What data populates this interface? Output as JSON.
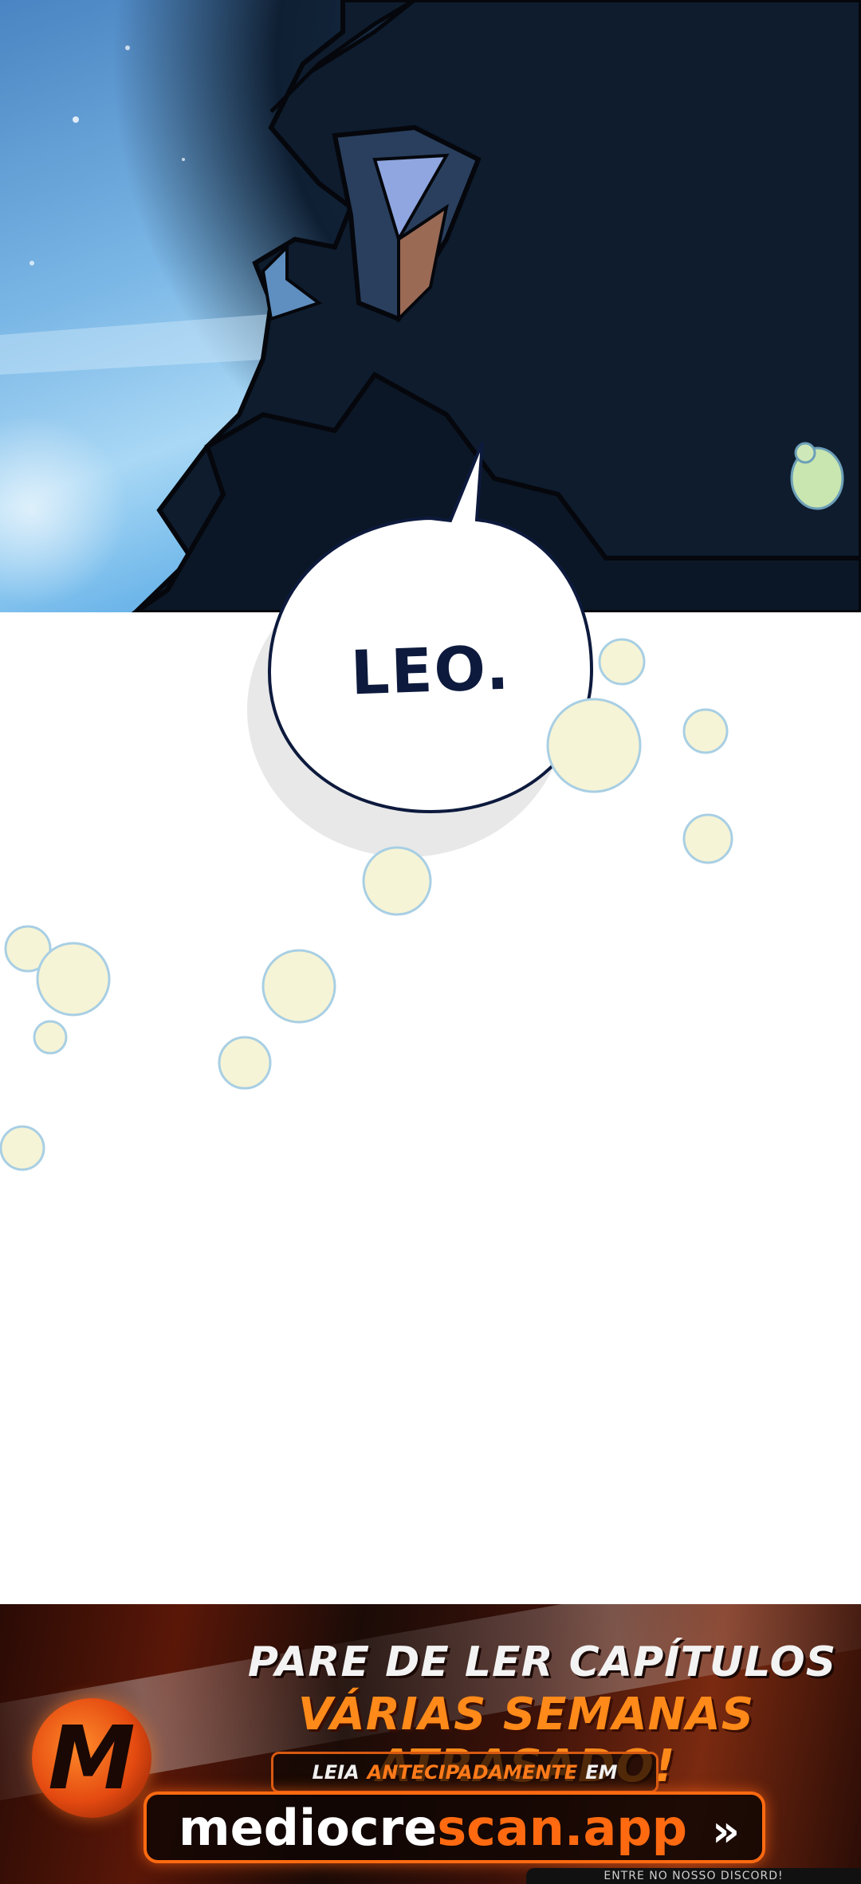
{
  "speech_bubble": {
    "text": "LEO."
  },
  "banner": {
    "headline_line1": "PARE DE LER CAPÍTULOS",
    "headline_line2": "VÁRIAS SEMANAS ATRASADO!",
    "lead_prefix": "LEIA",
    "lead_highlight": "ANTECIPADAMENTE",
    "lead_suffix": "EM",
    "url_part1": "mediocre",
    "url_part2": "scan.app",
    "url_arrows": "»",
    "logo_letter": "M",
    "discord_text": "ENTRE NO NOSSO DISCORD!"
  },
  "colors": {
    "accent_orange": "#ff6a10",
    "ink_navy": "#0d1a3d",
    "sky_blue": "#7bb7e6"
  }
}
